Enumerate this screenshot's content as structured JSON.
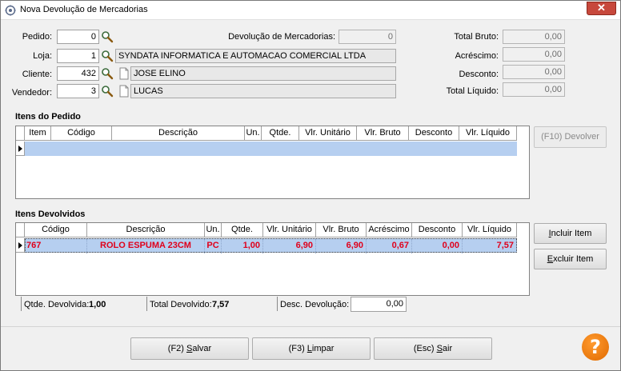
{
  "window": {
    "title": "Nova Devolução de Mercadorias",
    "close_glyph": "✕"
  },
  "header": {
    "pedido": {
      "label": "Pedido:",
      "value": "0"
    },
    "loja": {
      "label": "Loja:",
      "value": "1",
      "description": "SYNDATA INFORMATICA E AUTOMACAO COMERCIAL LTDA"
    },
    "cliente": {
      "label": "Cliente:",
      "value": "432",
      "description": "JOSE ELINO"
    },
    "vendedor": {
      "label": "Vendedor:",
      "value": "3",
      "description": "LUCAS"
    },
    "devolucao": {
      "label": "Devolução de Mercadorias:",
      "value": "0"
    }
  },
  "totals": {
    "total_bruto": {
      "label": "Total Bruto:",
      "value": "0,00"
    },
    "acrescimo": {
      "label": "Acréscimo:",
      "value": "0,00"
    },
    "desconto": {
      "label": "Desconto:",
      "value": "0,00"
    },
    "total_liquido": {
      "label": "Total Líquido:",
      "value": "0,00"
    }
  },
  "itens_pedido": {
    "title": "Itens do Pedido",
    "columns": [
      "Item",
      "Código",
      "Descrição",
      "Un.",
      "Qtde.",
      "Vlr. Unitário",
      "Vlr. Bruto",
      "Desconto",
      "Vlr. Líquido"
    ],
    "rows": []
  },
  "itens_devolvidos": {
    "title": "Itens Devolvidos",
    "columns": [
      "Código",
      "Descrição",
      "Un.",
      "Qtde.",
      "Vlr. Unitário",
      "Vlr. Bruto",
      "Acréscimo",
      "Desconto",
      "Vlr. Líquido"
    ],
    "rows": [
      [
        "767",
        "ROLO ESPUMA 23CM",
        "PC",
        "1,00",
        "6,90",
        "6,90",
        "0,67",
        "0,00",
        "7,57"
      ]
    ]
  },
  "status": {
    "qtde_devolvida_label": "Qtde. Devolvida:",
    "qtde_devolvida": "1,00",
    "total_devolvido_label": "Total Devolvido:",
    "total_devolvido": "7,57",
    "desc_devolucao_label": "Desc. Devolução:",
    "desc_devolucao": "0,00"
  },
  "buttons": {
    "devolver_label": "(F10) Devolver",
    "incluir_pre": "",
    "incluir_u": "I",
    "incluir_post": "ncluir Item",
    "excluir_pre": "",
    "excluir_u": "E",
    "excluir_post": "xcluir Item",
    "salvar_pre": "(F2) ",
    "salvar_u": "S",
    "salvar_post": "alvar",
    "limpar_pre": "(F3) ",
    "limpar_u": "L",
    "limpar_post": "impar",
    "sair_pre": "(Esc) ",
    "sair_u": "S",
    "sair_post": "air",
    "help_glyph": "?"
  },
  "colors": {
    "accent_red": "#e0001b",
    "selected_row": "#b6cff0",
    "help_orange": "#f08000",
    "close_red": "#c7483c"
  },
  "icons": [
    "app-icon",
    "search-icon",
    "document-icon",
    "row-indicator-icon",
    "help-icon"
  ]
}
